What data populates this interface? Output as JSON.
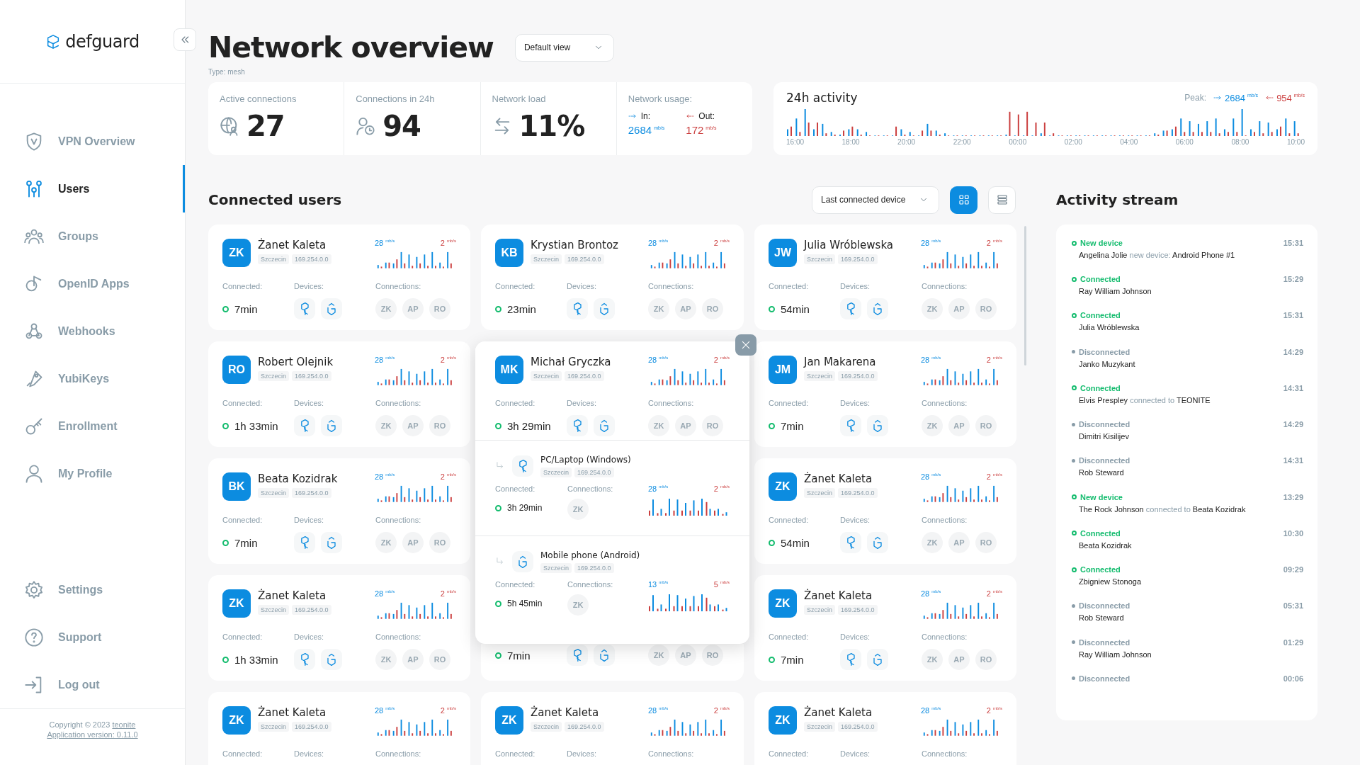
{
  "sidebar": {
    "brand": "defguard",
    "items": [
      {
        "label": "VPN Overview",
        "selected": false
      },
      {
        "label": "Users",
        "selected": true
      },
      {
        "label": "Groups",
        "selected": false
      },
      {
        "label": "OpenID Apps",
        "selected": false
      },
      {
        "label": "Webhooks",
        "selected": false
      },
      {
        "label": "YubiKeys",
        "selected": false
      },
      {
        "label": "Enrollment",
        "selected": false
      },
      {
        "label": "My Profile",
        "selected": false
      }
    ],
    "bottom_items": [
      {
        "label": "Settings",
        "selected": false
      },
      {
        "label": "Support",
        "selected": false
      },
      {
        "label": "Log out",
        "selected": false
      }
    ],
    "copyright": "Copyright © 2023",
    "copyright_link": "teonite",
    "version": "Application version: 0.11.0"
  },
  "header": {
    "title": "Network overview",
    "view_select": "Default view",
    "type": "Type: mesh"
  },
  "stats": [
    {
      "kind": "count",
      "label": "Active connections",
      "value": "27"
    },
    {
      "kind": "count",
      "label": "Connections in 24h",
      "value": "94"
    },
    {
      "kind": "count",
      "label": "Network load",
      "value": "11%"
    },
    {
      "kind": "usage",
      "label": "Network usage:",
      "in_label": "In:",
      "in_value": "2684",
      "in_unit": "mb/s",
      "out_label": "Out:",
      "out_value": "172",
      "out_unit": "mb/s"
    }
  ],
  "activity": {
    "title": "24h activity",
    "peak_label": "Peak:",
    "peak_in": "2684",
    "peak_in_unit": "mb/s",
    "peak_out": "954",
    "peak_out_unit": "mb/s",
    "x_labels": [
      "16:00",
      "18:00",
      "20:00",
      "22:00",
      "00:00",
      "02:00",
      "04:00",
      "06:00",
      "08:00",
      "10:00"
    ]
  },
  "connected_users": {
    "title": "Connected users",
    "sort_select": "Last connected device",
    "views": [
      {
        "kind": "grid",
        "selected": true
      },
      {
        "kind": "list",
        "selected": false
      }
    ],
    "covered_card": {
      "connected": "7min",
      "devices": [
        {
          "kind": "desktop"
        },
        {
          "kind": "mobile"
        }
      ],
      "connections": [
        "ZK",
        "AP",
        "RO"
      ]
    },
    "cards": [
      {
        "kind": "user",
        "initials": "ZK",
        "name": "Żanet Kaleta",
        "location": "Szczecin",
        "ip": "169.254.0.0",
        "traffic_in": {
          "value": "28",
          "unit": "mb/s"
        },
        "traffic_out": {
          "value": "2",
          "unit": "mb/s"
        },
        "labels": [
          "Connected:",
          "Devices:",
          "Connections:"
        ],
        "connected": "7min",
        "devices": [
          {
            "kind": "desktop"
          },
          {
            "kind": "mobile"
          }
        ],
        "connections": [
          "ZK",
          "AP",
          "RO"
        ]
      },
      {
        "kind": "user",
        "initials": "KB",
        "name": "Krystian Brontoz",
        "location": "Szczecin",
        "ip": "169.254.0.0",
        "traffic_in": {
          "value": "28",
          "unit": "mb/s"
        },
        "traffic_out": {
          "value": "2",
          "unit": "mb/s"
        },
        "labels": [
          "Connected:",
          "Devices:",
          "Connections:"
        ],
        "connected": "23min",
        "devices": [
          {
            "kind": "desktop"
          },
          {
            "kind": "mobile"
          }
        ],
        "connections": [
          "ZK",
          "AP",
          "RO"
        ]
      },
      {
        "kind": "user",
        "initials": "JW",
        "name": "Julia Wróblewska",
        "location": "Szczecin",
        "ip": "169.254.0.0",
        "traffic_in": {
          "value": "28",
          "unit": "mb/s"
        },
        "traffic_out": {
          "value": "2",
          "unit": "mb/s"
        },
        "labels": [
          "Connected:",
          "Devices:",
          "Connections:"
        ],
        "connected": "54min",
        "devices": [
          {
            "kind": "desktop"
          },
          {
            "kind": "mobile"
          }
        ],
        "connections": [
          "ZK",
          "AP",
          "RO"
        ]
      },
      {
        "kind": "user",
        "initials": "RO",
        "name": "Robert Olejnik",
        "location": "Szczecin",
        "ip": "169.254.0.0",
        "traffic_in": {
          "value": "28",
          "unit": "mb/s"
        },
        "traffic_out": {
          "value": "2",
          "unit": "mb/s"
        },
        "labels": [
          "Connected:",
          "Devices:",
          "Connections:"
        ],
        "connected": "1h 33min",
        "devices": [
          {
            "kind": "desktop"
          },
          {
            "kind": "mobile"
          }
        ],
        "connections": [
          "ZK",
          "AP",
          "RO"
        ]
      },
      {
        "kind": "expanded",
        "initials": "MK",
        "name": "Michał Gryczka",
        "location": "Szczecin",
        "ip": "169.254.0.0",
        "traffic_in": {
          "value": "28",
          "unit": "mb/s"
        },
        "traffic_out": {
          "value": "2",
          "unit": "mb/s"
        },
        "labels": [
          "Connected:",
          "Devices:",
          "Connections:"
        ],
        "connected": "3h 29min",
        "devices": [
          {
            "kind": "desktop"
          },
          {
            "kind": "mobile"
          }
        ],
        "connections": [
          "ZK",
          "AP",
          "RO"
        ],
        "device_rows": [
          {
            "kind": "desktop",
            "name": "PC/Laptop (Windows)",
            "location": "Szczecin",
            "ip": "169.254.0.0",
            "labels": [
              "Connected:",
              "Connections:"
            ],
            "connected": "3h 29min",
            "connections": [
              "ZK"
            ],
            "traffic_in": {
              "value": "28",
              "unit": "mb/s"
            },
            "traffic_out": {
              "value": "2",
              "unit": "mb/s"
            }
          },
          {
            "kind": "mobile",
            "name": "Mobile phone (Android)",
            "location": "Szczecin",
            "ip": "169.254.0.0",
            "labels": [
              "Connected:",
              "Connections:"
            ],
            "connected": "5h 45min",
            "connections": [
              "ZK"
            ],
            "traffic_in": {
              "value": "13",
              "unit": "mb/s"
            },
            "traffic_out": {
              "value": "5",
              "unit": "mb/s"
            }
          }
        ]
      },
      {
        "kind": "user",
        "initials": "JM",
        "name": "Jan Makarena",
        "location": "Szczecin",
        "ip": "169.254.0.0",
        "traffic_in": {
          "value": "28",
          "unit": "mb/s"
        },
        "traffic_out": {
          "value": "2",
          "unit": "mb/s"
        },
        "labels": [
          "Connected:",
          "Devices:",
          "Connections:"
        ],
        "connected": "7min",
        "devices": [
          {
            "kind": "desktop"
          },
          {
            "kind": "mobile"
          }
        ],
        "connections": [
          "ZK",
          "AP",
          "RO"
        ]
      },
      {
        "kind": "user",
        "initials": "BK",
        "name": "Beata Kozidrak",
        "location": "Szczecin",
        "ip": "169.254.0.0",
        "traffic_in": {
          "value": "28",
          "unit": "mb/s"
        },
        "traffic_out": {
          "value": "2",
          "unit": "mb/s"
        },
        "labels": [
          "Connected:",
          "Devices:",
          "Connections:"
        ],
        "connected": "7min",
        "devices": [
          {
            "kind": "desktop"
          },
          {
            "kind": "mobile"
          }
        ],
        "connections": [
          "ZK",
          "AP",
          "RO"
        ]
      },
      {
        "kind": "user",
        "initials": "ZK",
        "name": "Żanet Kaleta",
        "location": "Szczecin",
        "ip": "169.254.0.0",
        "traffic_in": {
          "value": "28",
          "unit": "mb/s"
        },
        "traffic_out": {
          "value": "2",
          "unit": "mb/s"
        },
        "labels": [
          "Connected:",
          "Devices:",
          "Connections:"
        ],
        "connected": "54min",
        "devices": [
          {
            "kind": "desktop"
          },
          {
            "kind": "mobile"
          }
        ],
        "connections": [
          "ZK",
          "AP",
          "RO"
        ]
      },
      {
        "kind": "user",
        "initials": "ZK",
        "name": "Żanet Kaleta",
        "location": "Szczecin",
        "ip": "169.254.0.0",
        "traffic_in": {
          "value": "28",
          "unit": "mb/s"
        },
        "traffic_out": {
          "value": "2",
          "unit": "mb/s"
        },
        "labels": [
          "Connected:",
          "Devices:",
          "Connections:"
        ],
        "connected": "1h 33min",
        "devices": [
          {
            "kind": "desktop"
          },
          {
            "kind": "mobile"
          }
        ],
        "connections": [
          "ZK",
          "AP",
          "RO"
        ]
      },
      {
        "kind": "user",
        "initials": "ZK",
        "name": "Żanet Kaleta",
        "location": "Szczecin",
        "ip": "169.254.0.0",
        "traffic_in": {
          "value": "28",
          "unit": "mb/s"
        },
        "traffic_out": {
          "value": "2",
          "unit": "mb/s"
        },
        "labels": [
          "Connected:",
          "Devices:",
          "Connections:"
        ],
        "connected": "7min",
        "devices": [
          {
            "kind": "desktop"
          },
          {
            "kind": "mobile"
          }
        ],
        "connections": [
          "ZK",
          "AP",
          "RO"
        ]
      },
      {
        "kind": "user",
        "initials": "ZK",
        "name": "Żanet Kaleta",
        "location": "Szczecin",
        "ip": "169.254.0.0",
        "traffic_in": {
          "value": "28",
          "unit": "mb/s"
        },
        "traffic_out": {
          "value": "2",
          "unit": "mb/s"
        },
        "labels": [
          "Connected:",
          "Devices:",
          "Connections:"
        ]
      },
      {
        "kind": "user",
        "initials": "ZK",
        "name": "Żanet Kaleta",
        "location": "Szczecin",
        "ip": "169.254.0.0",
        "traffic_in": {
          "value": "28",
          "unit": "mb/s"
        },
        "traffic_out": {
          "value": "2",
          "unit": "mb/s"
        },
        "labels": [
          "Connected:",
          "Devices:",
          "Connections:"
        ]
      },
      {
        "kind": "user",
        "initials": "ZK",
        "name": "Żanet Kaleta",
        "location": "Szczecin",
        "ip": "169.254.0.0",
        "traffic_in": {
          "value": "28",
          "unit": "mb/s"
        },
        "traffic_out": {
          "value": "2",
          "unit": "mb/s"
        },
        "labels": [
          "Connected:",
          "Devices:",
          "Connections:"
        ]
      }
    ]
  },
  "activity_stream": {
    "title": "Activity stream",
    "events": [
      {
        "kind": "new_device",
        "title": "New device",
        "time": "15:31",
        "subject": "Angelina Jolie",
        "action": "new device:",
        "object": "Android Phone #1"
      },
      {
        "kind": "connected",
        "title": "Connected",
        "time": "15:29",
        "subject": "Ray William Johnson"
      },
      {
        "kind": "connected",
        "title": "Connected",
        "time": "15:31",
        "subject": "Julia Wróblewska"
      },
      {
        "kind": "disconnected",
        "title": "Disconnected",
        "time": "14:29",
        "subject": "Janko Muzykant"
      },
      {
        "kind": "connected",
        "title": "Connected",
        "time": "14:31",
        "subject": "Elvis Prespley",
        "action": "connected to",
        "object": "TEONITE"
      },
      {
        "kind": "disconnected",
        "title": "Disconnected",
        "time": "14:29",
        "subject": "Dimitri Kisilijev"
      },
      {
        "kind": "disconnected",
        "title": "Disconnected",
        "time": "14:31",
        "subject": "Rob Steward"
      },
      {
        "kind": "new_device",
        "title": "New device",
        "time": "13:29",
        "subject": "The Rock Johnson",
        "action": "connected to",
        "object": "Beata Kozidrak"
      },
      {
        "kind": "connected",
        "title": "Connected",
        "time": "10:30",
        "subject": "Beata Kozidrak"
      },
      {
        "kind": "connected",
        "title": "Connected",
        "time": "09:29",
        "subject": "Zbigniew Stonoga"
      },
      {
        "kind": "disconnected",
        "title": "Disconnected",
        "time": "05:31",
        "subject": "Rob Steward"
      },
      {
        "kind": "disconnected",
        "title": "Disconnected",
        "time": "01:29",
        "subject": "Ray William Johnson"
      },
      {
        "kind": "disconnected",
        "title": "Disconnected",
        "time": "00:06"
      }
    ]
  }
}
